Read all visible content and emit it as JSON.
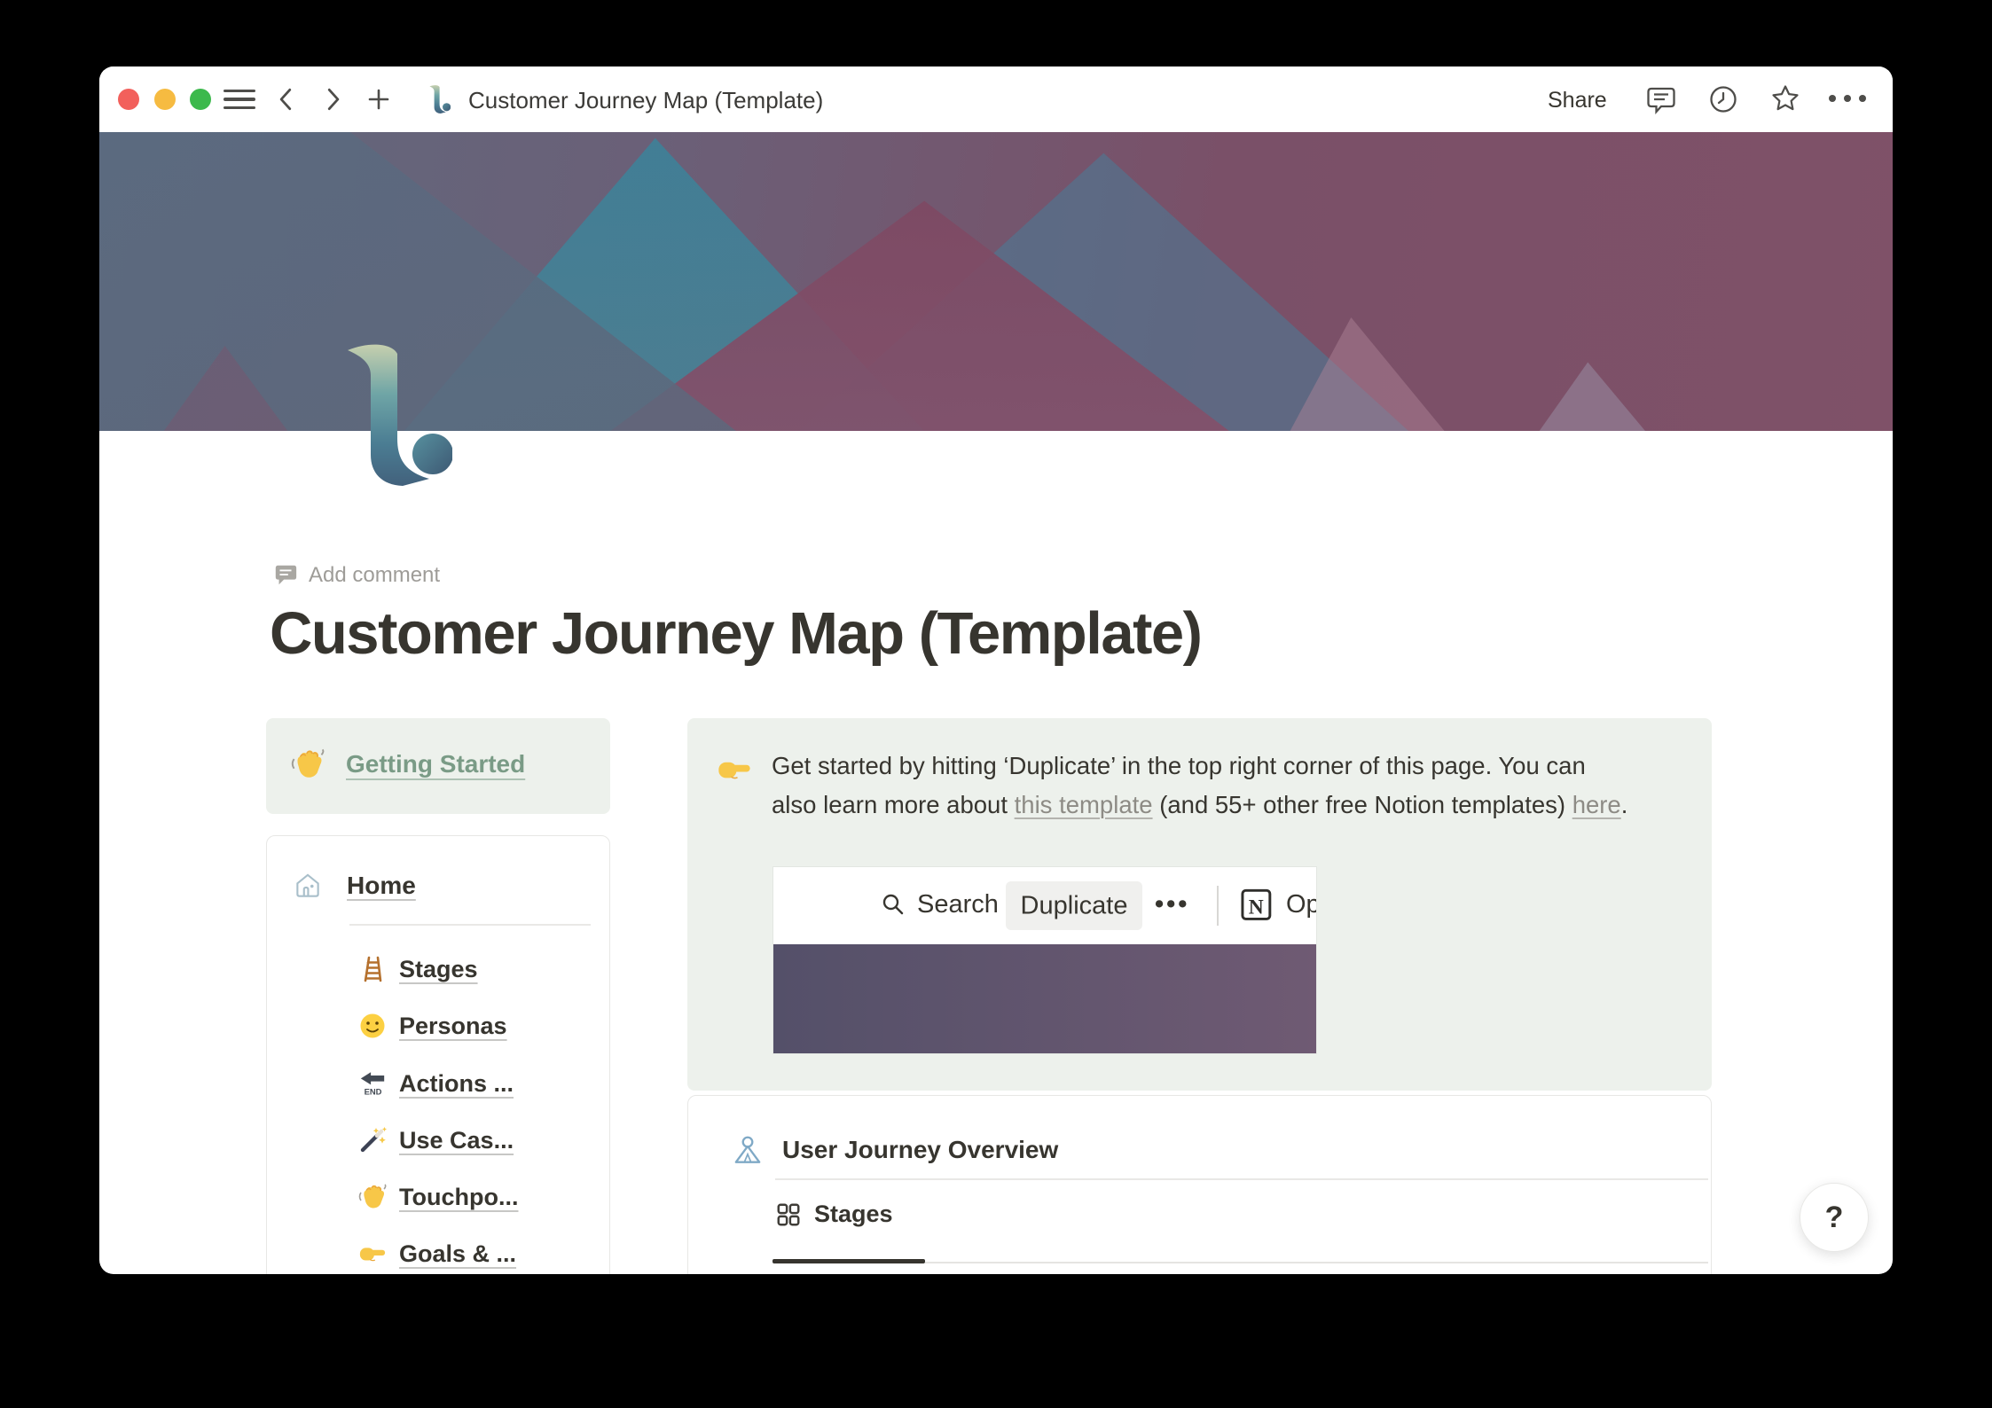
{
  "titlebar": {
    "title": "Customer Journey Map (Template)",
    "share": "Share"
  },
  "page": {
    "add_comment": "Add comment",
    "title": "Customer Journey Map (Template)"
  },
  "left_column": {
    "getting_started": {
      "emoji": "👋",
      "label": "Getting Started"
    },
    "home": {
      "label": "Home",
      "items": [
        {
          "emoji": "🪜",
          "label": "Stages"
        },
        {
          "emoji": "🙂",
          "label": "Personas"
        },
        {
          "emoji": "🔚",
          "emoji_caption": "END",
          "label": "Actions ..."
        },
        {
          "emoji": "🪄",
          "label": "Use Cas..."
        },
        {
          "emoji": "👋",
          "label": "Touchpo..."
        },
        {
          "emoji": "👉",
          "label": "Goals & ..."
        }
      ]
    }
  },
  "callout": {
    "emoji": "👉",
    "line1": "Get started by hitting ‘Duplicate’ in the top right corner of this page. You can",
    "line2_before": "also learn more about ",
    "link_template": "this template",
    "line2_middle": " (and 55+ other free Notion templates) ",
    "link_here": "here",
    "line2_end": ".",
    "screenshot": {
      "search": "Search",
      "duplicate": "Duplicate",
      "more": "•••",
      "notion_letter": "N",
      "open_partial": "Op"
    }
  },
  "overview": {
    "title": "User Journey Overview",
    "tabs": [
      {
        "label": "Stages",
        "active": true
      }
    ]
  },
  "help": {
    "label": "?"
  },
  "colors": {
    "getting_started_green": "#7a9b86",
    "callout_bg": "#edf1ec",
    "cover_teal": "#44809b",
    "cover_maroon": "#7e4a63",
    "cover_slate": "#5d6a7e",
    "embed_cover_purple": "#5b5570",
    "active_tab": "#37352f"
  }
}
